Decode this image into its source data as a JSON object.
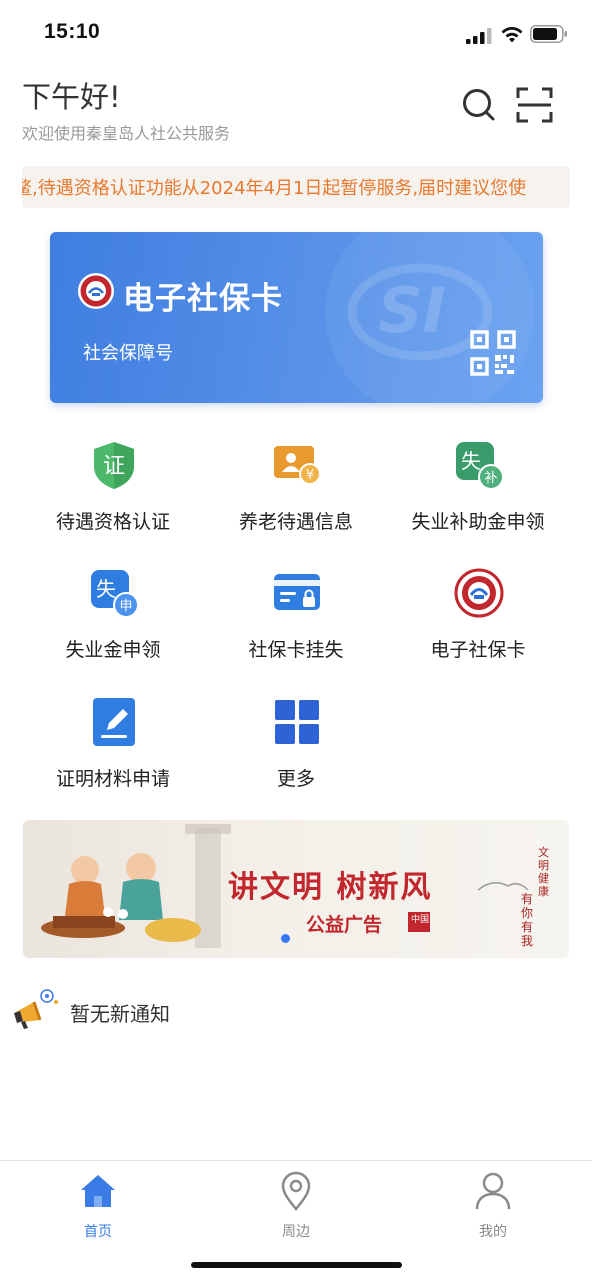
{
  "status_bar": {
    "time": "15:10"
  },
  "header": {
    "greeting": "下午好!",
    "subtitle": "欢迎使用秦皇岛人社公共服务",
    "search_icon": "search-icon",
    "scan_icon": "scan-icon"
  },
  "marquee": {
    "text": "鳌,待遇资格认证功能从2024年4月1日起暂停服务,届时建议您使"
  },
  "card": {
    "title": "电子社保卡",
    "subtitle": "社会保障号",
    "watermark": "SI",
    "qr_icon": "qr-code-icon"
  },
  "services": [
    {
      "label": "待遇资格认证",
      "glyph": "证",
      "icon": "certificate-shield-icon",
      "color": "#4cb86a"
    },
    {
      "label": "养老待遇信息",
      "glyph": "¥",
      "icon": "pension-info-icon",
      "color": "#e89a2e"
    },
    {
      "label": "失业补助金申领",
      "glyph": "失",
      "glyph2": "补",
      "icon": "unemployment-subsidy-icon",
      "color": "#3a9c6b"
    },
    {
      "label": "失业金申领",
      "glyph": "失",
      "glyph2": "申",
      "icon": "unemployment-benefit-icon",
      "color": "#2f7de1"
    },
    {
      "label": "社保卡挂失",
      "icon": "card-lock-icon",
      "color": "#2f7de1"
    },
    {
      "label": "电子社保卡",
      "icon": "social-security-emblem-icon",
      "color": "#c1272d"
    },
    {
      "label": "证明材料申请",
      "icon": "document-edit-icon",
      "color": "#2f7de1"
    },
    {
      "label": "更多",
      "icon": "grid-more-icon",
      "color": "#2d63d4"
    }
  ],
  "banner": {
    "headline": "讲文明 树新风",
    "subline": "公益广告",
    "vertical_1": "文明健康",
    "vertical_2": "有你有我",
    "seal": "中国"
  },
  "notice": {
    "text": "暂无新通知",
    "icon": "megaphone-icon"
  },
  "tabbar": {
    "items": [
      {
        "label": "首页",
        "icon": "home-icon",
        "active": true
      },
      {
        "label": "周边",
        "icon": "location-pin-icon",
        "active": false
      },
      {
        "label": "我的",
        "icon": "user-icon",
        "active": false
      }
    ],
    "active_color": "#3a7be6",
    "inactive_color": "#8a8a8a"
  }
}
